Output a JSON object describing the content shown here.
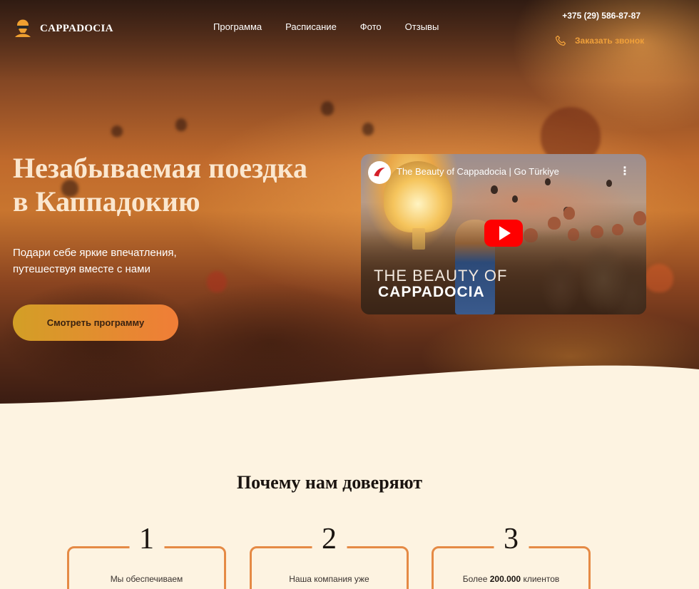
{
  "header": {
    "logo_text": "CAPPADOCIA",
    "nav": [
      "Программа",
      "Расписание",
      "Фото",
      "Отзывы"
    ],
    "phone": "+375 (29) 586-87-87",
    "callback_label": "Заказать звонок"
  },
  "hero": {
    "title_line1": "Незабываемая поездка",
    "title_line2": "в Каппадокию",
    "subtitle_line1": "Подари себе яркие впечатления,",
    "subtitle_line2": "путешествуя вместе с нами",
    "cta_label": "Смотреть программу"
  },
  "video": {
    "title": "The Beauty of Cappadocia | Go Türkiye",
    "menu_glyph": "⋮",
    "overlay_line1": "THE BEAUTY OF",
    "overlay_line2": "CAPPADOCIA"
  },
  "why": {
    "title": "Почему нам доверяют",
    "cards": [
      {
        "num": "1",
        "text": "Мы обеспечиваем"
      },
      {
        "num": "2",
        "text": "Наша компания уже"
      },
      {
        "num": "3",
        "text_pre": "Более ",
        "text_bold": "200.000",
        "text_post": " клиентов"
      }
    ]
  },
  "colors": {
    "accent_orange": "#e58a45",
    "cta_gradient_start": "#d39f26",
    "cta_gradient_end": "#f07d37",
    "callback_color": "#f0a03a",
    "section_bg": "#fdf3e1"
  },
  "icons": {
    "logo": "balloon-logo-icon",
    "callback": "phone-icon",
    "play": "youtube-play-icon"
  }
}
